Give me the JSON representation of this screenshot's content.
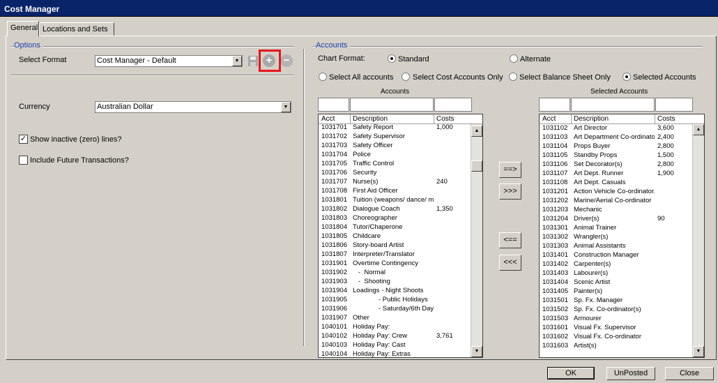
{
  "window": {
    "title": "Cost Manager"
  },
  "tabs": [
    {
      "label": "General"
    },
    {
      "label": "Locations and Sets"
    }
  ],
  "options": {
    "group_title": "Options",
    "select_format_label": "Select Format",
    "format_value": "Cost Manager - Default",
    "currency_label": "Currency",
    "currency_value": "Australian Dollar",
    "show_inactive_label": "Show inactive (zero) lines?",
    "show_inactive_checked": true,
    "include_future_label": "Include Future Transactions?",
    "include_future_checked": false
  },
  "accounts": {
    "group_title": "Accounts",
    "chart_format_label": "Chart Format:",
    "standard_label": "Standard",
    "alternate_label": "Alternate",
    "select_all_label": "Select All accounts",
    "select_cost_label": "Select Cost Accounts Only",
    "select_balance_label": "Select Balance Sheet Only",
    "selected_accounts_label": "Selected Accounts",
    "accounts_list_title": "Accounts",
    "selected_list_title": "Selected Accounts",
    "columns": {
      "acct": "Acct",
      "description": "Description",
      "costs": "Costs"
    },
    "available": [
      [
        "1031701",
        "Safety Report",
        "1,000"
      ],
      [
        "1031702",
        "Safety Supervisor",
        ""
      ],
      [
        "1031703",
        "Safety Officer",
        ""
      ],
      [
        "1031704",
        "Police",
        ""
      ],
      [
        "1031705",
        "Traffic Control",
        ""
      ],
      [
        "1031706",
        "Security",
        ""
      ],
      [
        "1031707",
        "Nurse(s)",
        "240"
      ],
      [
        "1031708",
        "First Aid Officer",
        ""
      ],
      [
        "1031801",
        "Tuition (weapons/ dance/ m",
        ""
      ],
      [
        "1031802",
        "Dialogue Coach",
        "1,350"
      ],
      [
        "1031803",
        "Choreographer",
        ""
      ],
      [
        "1031804",
        "Tutor/Chaperone",
        ""
      ],
      [
        "1031805",
        "Childcare",
        ""
      ],
      [
        "1031806",
        "Story-board Artist",
        ""
      ],
      [
        "1031807",
        "Interpreter/Translator",
        ""
      ],
      [
        "1031901",
        "Overtime Contingency",
        ""
      ],
      [
        "1031902",
        "   -  Normal",
        ""
      ],
      [
        "1031903",
        "   -  Shooting",
        ""
      ],
      [
        "1031904",
        "Loadings - Night Shoots",
        ""
      ],
      [
        "1031905",
        "              - Public Holidays",
        ""
      ],
      [
        "1031906",
        "              - Saturday/6th Day",
        ""
      ],
      [
        "1031907",
        "Other",
        ""
      ],
      [
        "1040101",
        "Holiday Pay:",
        ""
      ],
      [
        "1040102",
        "Holiday Pay: Crew",
        "3,761"
      ],
      [
        "1040103",
        "Holiday Pay: Cast",
        ""
      ],
      [
        "1040104",
        "Holiday Pay: Extras",
        ""
      ]
    ],
    "selected": [
      [
        "1031102",
        "Art Director",
        "3,600"
      ],
      [
        "1031103",
        "Art Department Co-ordinato",
        "2,400"
      ],
      [
        "1031104",
        "Props Buyer",
        "2,800"
      ],
      [
        "1031105",
        "Standby Props",
        "1,500"
      ],
      [
        "1031106",
        "Set Decorator(s)",
        "2,800"
      ],
      [
        "1031107",
        "Art Dept. Runner",
        "1,900"
      ],
      [
        "1031108",
        "Art Dept. Casuals",
        ""
      ],
      [
        "1031201",
        "Action Vehicle Co-ordinator.",
        ""
      ],
      [
        "1031202",
        "Marine/Aerial Co-ordinator",
        ""
      ],
      [
        "1031203",
        "Mechanic",
        ""
      ],
      [
        "1031204",
        "Driver(s)",
        "90"
      ],
      [
        "1031301",
        "Animal Trainer",
        ""
      ],
      [
        "1031302",
        "Wrangler(s)",
        ""
      ],
      [
        "1031303",
        "Animal Assistants",
        ""
      ],
      [
        "1031401",
        "Construction Manager",
        ""
      ],
      [
        "1031402",
        "Carpenter(s)",
        ""
      ],
      [
        "1031403",
        "Labourer(s)",
        ""
      ],
      [
        "1031404",
        "Scenic Artist",
        ""
      ],
      [
        "1031405",
        "Painter(s)",
        ""
      ],
      [
        "1031501",
        "Sp. Fx. Manager",
        ""
      ],
      [
        "1031502",
        "Sp. Fx. Co-ordinator(s)",
        ""
      ],
      [
        "1031503",
        "Armourer",
        ""
      ],
      [
        "1031601",
        "Visual Fx. Supervisor",
        ""
      ],
      [
        "1031602",
        "Visual Fx. Co-ordinator",
        ""
      ],
      [
        "1031603",
        "Artist(s)",
        ""
      ]
    ],
    "move_buttons": {
      "add_selected": "==>",
      "add_all": ">>>",
      "remove_selected": "<==",
      "remove_all": "<<<"
    }
  },
  "footer": {
    "ok": "OK",
    "unposted": "UnPosted",
    "close": "Close"
  }
}
